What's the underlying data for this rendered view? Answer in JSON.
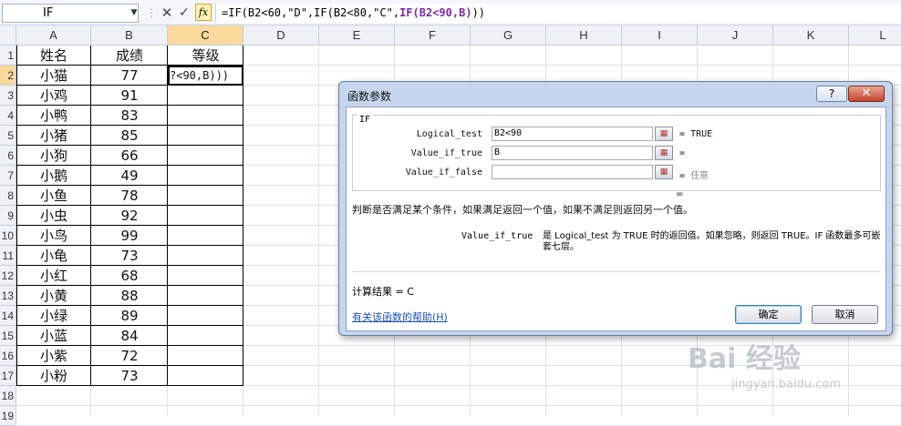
{
  "formula_bar": {
    "name_box": "IF",
    "fx_label": "fx",
    "formula_prefix": "=IF(B2<60,\"D\",IF(B2<80,\"C\",",
    "formula_bold": "IF(B2<90,B",
    "formula_suffix": "))"
  },
  "columns": [
    "A",
    "B",
    "C",
    "D",
    "E",
    "F",
    "G",
    "H",
    "I",
    "J",
    "K",
    "L"
  ],
  "rows": [
    "1",
    "2",
    "3",
    "4",
    "5",
    "6",
    "7",
    "8",
    "9",
    "10",
    "11",
    "12",
    "13",
    "14",
    "15",
    "16",
    "17",
    "18",
    "19"
  ],
  "table": {
    "headers": [
      "姓名",
      "成绩",
      "等级"
    ],
    "active_cell_text": "?<90,B)))",
    "records": [
      {
        "name": "小猫",
        "score": "77"
      },
      {
        "name": "小鸡",
        "score": "91"
      },
      {
        "name": "小鸭",
        "score": "83"
      },
      {
        "name": "小猪",
        "score": "85"
      },
      {
        "name": "小狗",
        "score": "66"
      },
      {
        "name": "小鹅",
        "score": "49"
      },
      {
        "name": "小鱼",
        "score": "78"
      },
      {
        "name": "小虫",
        "score": "92"
      },
      {
        "name": "小鸟",
        "score": "99"
      },
      {
        "name": "小龟",
        "score": "73"
      },
      {
        "name": "小红",
        "score": "68"
      },
      {
        "name": "小黄",
        "score": "88"
      },
      {
        "name": "小绿",
        "score": "89"
      },
      {
        "name": "小蓝",
        "score": "84"
      },
      {
        "name": "小紫",
        "score": "72"
      },
      {
        "name": "小粉",
        "score": "73"
      }
    ]
  },
  "dialog": {
    "title": "函数参数",
    "help_button": "?",
    "close_button": "✕",
    "function_name": "IF",
    "args": [
      {
        "label": "Logical_test",
        "value": "B2<90",
        "eq": "=",
        "result": "TRUE"
      },
      {
        "label": "Value_if_true",
        "value": "B",
        "eq": "=",
        "result": ""
      },
      {
        "label": "Value_if_false",
        "value": "",
        "eq": "=",
        "result": "任意"
      }
    ],
    "overall_eq": "=",
    "description": "判断是否满足某个条件，如果满足返回一个值，如果不满足则返回另一个值。",
    "arg_desc_name": "Value_if_true",
    "arg_desc_text": "是 Logical_test 为 TRUE 时的返回值。如果忽略，则返回 TRUE。IF 函数最多可嵌套七层。",
    "result_label": "计算结果 =",
    "result_value": "C",
    "help_link": "有关该函数的帮助(H)",
    "ok_button": "确定",
    "cancel_button": "取消"
  },
  "watermark": {
    "logo": "Bai 经验",
    "url": "jingyan.baidu.com"
  }
}
